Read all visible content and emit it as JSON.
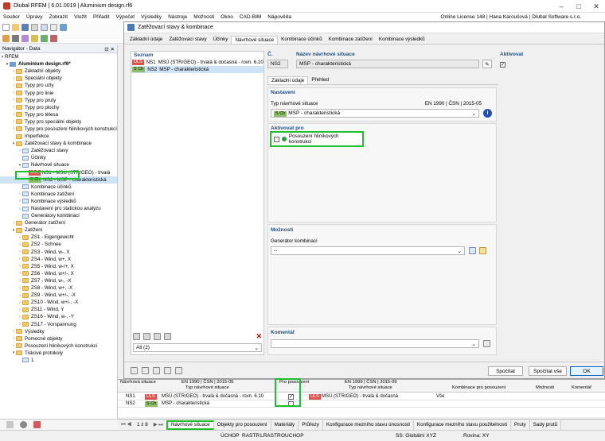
{
  "app": {
    "title": "Dlubal RFEM | 6.01.0019 | Aluminium design.rf6",
    "license": "Online License 148 | Hana Karoušová | Dlubal Software s.r.o."
  },
  "menu": [
    "Soubor",
    "Úpravy",
    "Zobrazit",
    "Vložit",
    "Přiřadit",
    "Výpočet",
    "Výsledky",
    "Nástroje",
    "Možnosti",
    "Okno",
    "CAD-BIM",
    "Nápověda"
  ],
  "navigator": {
    "title": "Navigátor - Data",
    "root": "RFEM",
    "file": "Aluminium design.rf6*",
    "items": [
      {
        "label": "Základní objekty",
        "level": 1,
        "kind": "folder",
        "exp": ">"
      },
      {
        "label": "Speciální objekty",
        "level": 1,
        "kind": "folder",
        "exp": ">"
      },
      {
        "label": "Typy pro uzly",
        "level": 1,
        "kind": "folder",
        "exp": ">"
      },
      {
        "label": "Typy pro linie",
        "level": 1,
        "kind": "folder",
        "exp": ">"
      },
      {
        "label": "Typy pro pruty",
        "level": 1,
        "kind": "folder",
        "exp": ">"
      },
      {
        "label": "Typy pro plochy",
        "level": 1,
        "kind": "folder",
        "exp": ">"
      },
      {
        "label": "Typy pro tělesa",
        "level": 1,
        "kind": "folder",
        "exp": ">"
      },
      {
        "label": "Typy pro speciální objekty",
        "level": 1,
        "kind": "folder",
        "exp": ">"
      },
      {
        "label": "Typy pro posouzení hliníkových konstrukcí",
        "level": 1,
        "kind": "folder",
        "exp": ">"
      },
      {
        "label": "Imperfekce",
        "level": 1,
        "kind": "folder",
        "exp": ""
      },
      {
        "label": "Zatěžovací stavy & kombinace",
        "level": 1,
        "kind": "folder",
        "exp": "v"
      },
      {
        "label": "Zatěžovací stavy",
        "level": 2,
        "kind": "item",
        "exp": ">"
      },
      {
        "label": "Účinky",
        "level": 2,
        "kind": "item",
        "exp": ""
      },
      {
        "label": "Návrhové situace",
        "level": 2,
        "kind": "item",
        "exp": "v",
        "highlight": true
      },
      {
        "label": "NS1 - MSÚ (STR/GEO) - trvalá",
        "level": 3,
        "kind": "tag",
        "tag": "ULS",
        "tagclass": "uls",
        "exp": ""
      },
      {
        "label": "NS2 - MSP - charakteristická",
        "level": 3,
        "kind": "tag",
        "tag": "S Ch",
        "tagclass": "sch",
        "exp": "",
        "selected": true
      },
      {
        "label": "Kombinace účinků",
        "level": 2,
        "kind": "item",
        "exp": ""
      },
      {
        "label": "Kombinace zatížení",
        "level": 2,
        "kind": "item",
        "exp": ">"
      },
      {
        "label": "Kombinace výsledků",
        "level": 2,
        "kind": "item",
        "exp": ">"
      },
      {
        "label": "Nastavení pro statickou analýzu",
        "level": 2,
        "kind": "item",
        "exp": ">"
      },
      {
        "label": "Generátory kombinací",
        "level": 2,
        "kind": "item",
        "exp": ""
      },
      {
        "label": "Generátor zatížení",
        "level": 1,
        "kind": "folder",
        "exp": ">"
      },
      {
        "label": "Zatížení",
        "level": 1,
        "kind": "folder",
        "exp": "v"
      },
      {
        "label": "ZS1 - Eigengewicht",
        "level": 2,
        "kind": "folder",
        "exp": ">"
      },
      {
        "label": "ZS2 - Schnee",
        "level": 2,
        "kind": "folder",
        "exp": ">"
      },
      {
        "label": "ZS3 - Wind, w-, X",
        "level": 2,
        "kind": "folder",
        "exp": ">"
      },
      {
        "label": "ZS4 - Wind, w+, X",
        "level": 2,
        "kind": "folder",
        "exp": ">"
      },
      {
        "label": "ZS5 - Wind, w-/+, X",
        "level": 2,
        "kind": "folder",
        "exp": ">"
      },
      {
        "label": "ZS6 - Wind, w+/-, X",
        "level": 2,
        "kind": "folder",
        "exp": ">"
      },
      {
        "label": "ZS7 - Wind, w-, -X",
        "level": 2,
        "kind": "folder",
        "exp": ">"
      },
      {
        "label": "ZS8 - Wind, w+, -X",
        "level": 2,
        "kind": "folder",
        "exp": ">"
      },
      {
        "label": "ZS9 - Wind, w+/-, -X",
        "level": 2,
        "kind": "folder",
        "exp": ">"
      },
      {
        "label": "ZS10 - Wind, w+/-, -X",
        "level": 2,
        "kind": "folder",
        "exp": ">"
      },
      {
        "label": "ZS11 - Wind, Y",
        "level": 2,
        "kind": "folder",
        "exp": ">"
      },
      {
        "label": "ZS16 - Wind, w-, -Y",
        "level": 2,
        "kind": "folder",
        "exp": ">"
      },
      {
        "label": "ZS17 - Vorspannung",
        "level": 2,
        "kind": "folder",
        "exp": ">"
      },
      {
        "label": "Výsledky",
        "level": 1,
        "kind": "folder",
        "exp": ">"
      },
      {
        "label": "Pomocné objekty",
        "level": 1,
        "kind": "folder",
        "exp": ">"
      },
      {
        "label": "Posouzení hliníkových konstrukcí",
        "level": 1,
        "kind": "folder",
        "exp": ">"
      },
      {
        "label": "Tiskové protokoly",
        "level": 1,
        "kind": "folder",
        "exp": "v"
      },
      {
        "label": "1",
        "level": 2,
        "kind": "item",
        "exp": ""
      }
    ]
  },
  "dialog": {
    "title": "Zatěžovací stavy & kombinace",
    "tabs": [
      "Základní údaje",
      "Zatěžovací stavy",
      "Účinky",
      "Návrhové situace",
      "Kombinace účinků",
      "Kombinace zatížení",
      "Kombinace výsledků"
    ],
    "active_tab": 3,
    "list_label": "Seznam",
    "list": [
      {
        "tag": "ULS",
        "tagclass": "uls",
        "id": "NS1",
        "text": "MSÚ (STR/GEO) - trvalá & dočasná - rovn. 6.10"
      },
      {
        "tag": "S Ch",
        "tagclass": "sch",
        "id": "NS2",
        "text": "MSP - charakteristická",
        "selected": true
      }
    ],
    "list_filter": "All (2)",
    "no_label": "Č.",
    "no_value": "NS2",
    "name_label": "Název návrhové situace",
    "name_value": "MSP - charakteristická",
    "activate_label": "Aktivovat",
    "inner_tabs": [
      "Základní údaje",
      "Přehled"
    ],
    "settings_label": "Nastavení",
    "type_label": "Typ návrhové situace",
    "type_norm": "EN 1990 | ČSN | 2015-05",
    "type_tag": "S Ch",
    "type_value": "MSP - charakteristická",
    "activate_for_label": "Aktivovat pro",
    "activate_for_item": "Posouzení hliníkových konstrukcí",
    "options_label": "Možnosti",
    "generator_label": "Generátor kombinací",
    "generator_value": "--",
    "comment_label": "Komentář",
    "buttons": {
      "calculate": "Spočítat",
      "calculate_all": "Spočítat vše",
      "ok": "OK"
    }
  },
  "table": {
    "headers": {
      "ns": "Návrhová situace",
      "norm1": "EN 1990 | ČSN | 2015-05",
      "type1": "Typ návrhové situace",
      "pro": "Pro posouzení",
      "norm2": "EN 1999 | ČSN | 2015-09",
      "type2": "Typ návrhové situace",
      "combo": "Kombinace pro posouzení",
      "options": "Možnosti",
      "comment": "Komentář"
    },
    "rows": [
      {
        "ns": "NS1",
        "tag": "ULS",
        "tagclass": "uls",
        "type": "MSÚ (STR/GEO) - trvalá & dočasná - rovn. 6.10",
        "checked": "✓",
        "tag2": "ULS",
        "type2": "MSÚ (STR/GEO) - trvalá & dočasná",
        "combo": "Vše"
      },
      {
        "ns": "NS2",
        "tag": "S Ch",
        "tagclass": "sch",
        "type": "MSP - charakteristická",
        "checked": "",
        "tag2": "",
        "type2": "",
        "combo": ""
      }
    ],
    "pager": "1 z 8"
  },
  "sheet_tabs": [
    "Návrhové situace",
    "Objekty pro posouzení",
    "Materiály",
    "Průřezy",
    "Konfigurace mezního stavu únosnosti",
    "Konfigurace mezního stavu použitelnosti",
    "Pruty",
    "Sady prutů"
  ],
  "status": [
    "ÚCHOP",
    "RASTR",
    "LRASTR",
    "OUCHOP",
    "SS: Globální XYZ",
    "Rovina: XY"
  ]
}
